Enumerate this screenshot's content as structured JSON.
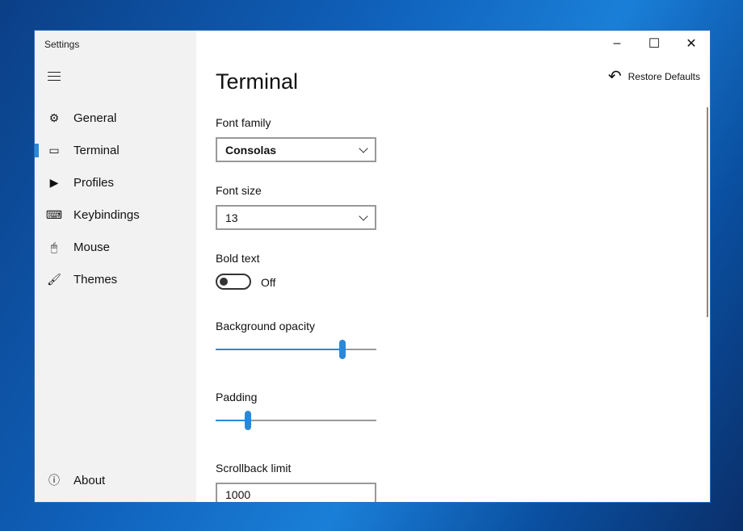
{
  "window": {
    "title": "Settings",
    "minimize": "–",
    "maximize": "☐",
    "close": "✕"
  },
  "sidebar": {
    "items": [
      {
        "label": "General",
        "icon": "⚙"
      },
      {
        "label": "Terminal",
        "icon": "▭"
      },
      {
        "label": "Profiles",
        "icon": "▶"
      },
      {
        "label": "Keybindings",
        "icon": "⌨"
      },
      {
        "label": "Mouse",
        "icon": "🖱"
      },
      {
        "label": "Themes",
        "icon": "🖌"
      }
    ],
    "about": {
      "label": "About",
      "icon": "ⓘ"
    }
  },
  "page": {
    "title": "Terminal",
    "restore_label": "Restore Defaults",
    "restore_icon": "↶",
    "font_family": {
      "label": "Font family",
      "value": "Consolas"
    },
    "font_size": {
      "label": "Font size",
      "value": "13"
    },
    "bold_text": {
      "label": "Bold text",
      "state": "Off"
    },
    "background_opacity": {
      "label": "Background opacity",
      "value_percent": 79
    },
    "padding": {
      "label": "Padding",
      "value_percent": 20
    },
    "scrollback": {
      "label": "Scrollback limit",
      "value": "1000"
    }
  },
  "accent": "#2b88d8"
}
